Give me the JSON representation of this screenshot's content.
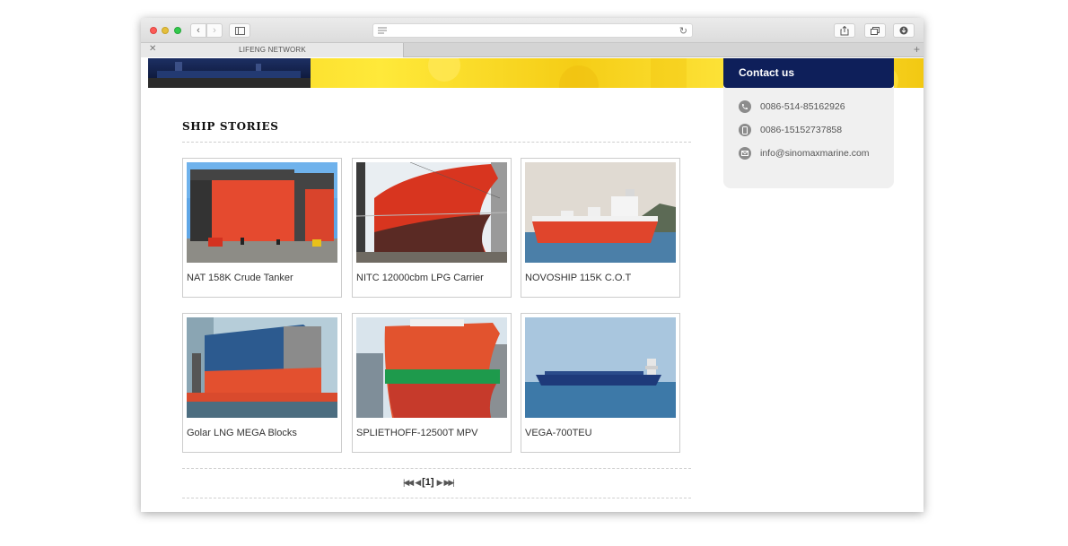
{
  "browser": {
    "tab_title": "LIFENG NETWORK",
    "close_tab_glyph": "✕",
    "new_tab_glyph": "+",
    "back_glyph": "‹",
    "forward_glyph": "›"
  },
  "page": {
    "section_title": "SHIP STORIES",
    "stories": [
      {
        "caption": "NAT 158K Crude Tanker"
      },
      {
        "caption": "NITC 12000cbm LPG Carrier"
      },
      {
        "caption": "NOVOSHIP 115K C.O.T"
      },
      {
        "caption": "Golar LNG MEGA Blocks"
      },
      {
        "caption": "SPLIETHOFF-12500T MPV"
      },
      {
        "caption": "VEGA-700TEU"
      }
    ],
    "pagination": {
      "first": "|◀◀",
      "prev": "◀",
      "current": "[1]",
      "next": "▶",
      "last": "▶▶|"
    }
  },
  "contact": {
    "heading": "Contact us",
    "phone": "0086-514-85162926",
    "mobile": "0086-15152737858",
    "email": "info@sinomaxmarine.com"
  },
  "colors": {
    "contact_header": "#0e1f5a",
    "banner_yellow": "#f7d21a"
  }
}
